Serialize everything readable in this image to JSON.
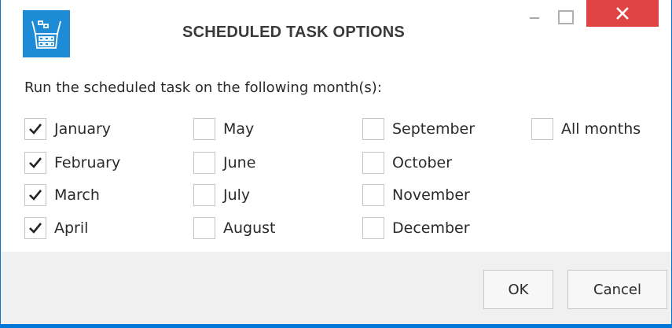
{
  "window": {
    "title": "SCHEDULED TASK OPTIONS",
    "accent_color": "#0078d7",
    "close_color": "#e04343",
    "icon": "calendar-basket-icon"
  },
  "prompt": "Run the scheduled task on the following month(s):",
  "months": [
    {
      "label": "January",
      "checked": true
    },
    {
      "label": "February",
      "checked": true
    },
    {
      "label": "March",
      "checked": true
    },
    {
      "label": "April",
      "checked": true
    },
    {
      "label": "May",
      "checked": false
    },
    {
      "label": "June",
      "checked": false
    },
    {
      "label": "July",
      "checked": false
    },
    {
      "label": "August",
      "checked": false
    },
    {
      "label": "September",
      "checked": false
    },
    {
      "label": "October",
      "checked": false
    },
    {
      "label": "November",
      "checked": false
    },
    {
      "label": "December",
      "checked": false
    }
  ],
  "all_months": {
    "label": "All months",
    "checked": false
  },
  "buttons": {
    "ok": "OK",
    "cancel": "Cancel"
  }
}
